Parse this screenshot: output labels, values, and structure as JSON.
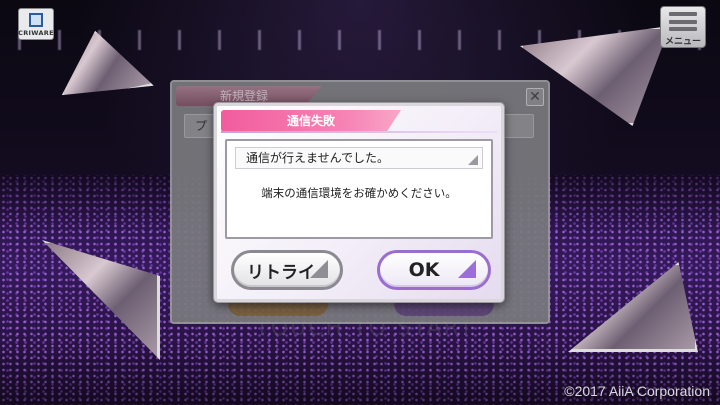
{
  "header": {
    "logo_text": "CRIWARE",
    "menu_label": "メニュー"
  },
  "background": {
    "touch_to_start": "TOUCH TO START",
    "copyright": "©2017 AiiA Corporation"
  },
  "registration_panel": {
    "title": "新規登録",
    "field_text": "プ",
    "close_icon": "close-icon"
  },
  "dialog": {
    "title": "通信失敗",
    "headline": "通信が行えませんでした。",
    "message": "端末の通信環境をお確かめください。",
    "retry_label": "リトライ",
    "ok_label": "OK",
    "accent_color": "#f25c9e",
    "ok_border_color": "#9a6dd0"
  }
}
